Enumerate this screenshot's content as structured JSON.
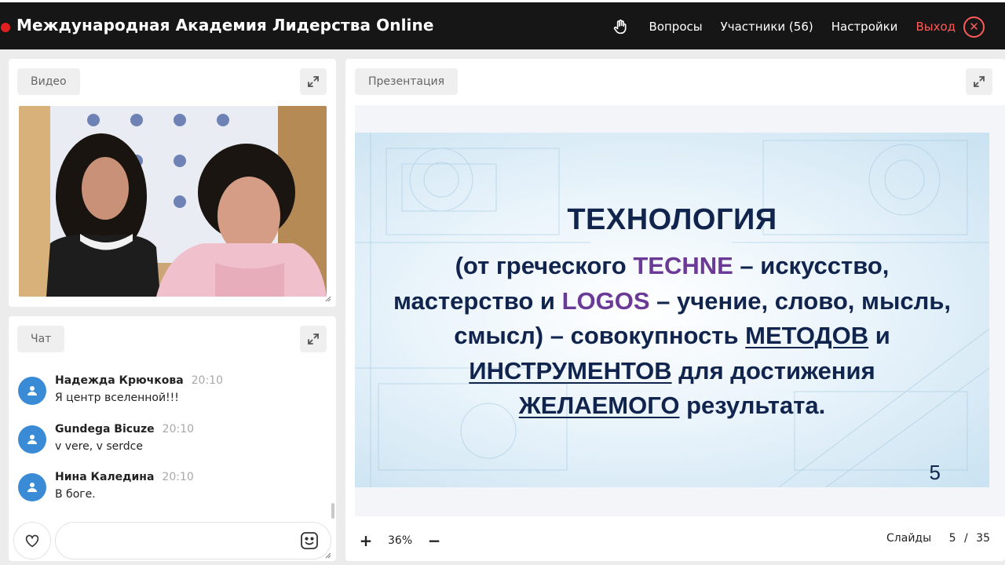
{
  "header": {
    "title": "Международная Академия Лидерства Online",
    "nav": {
      "questions": "Вопросы",
      "participants": "Участники (56)",
      "settings": "Настройки",
      "exit": "Выход"
    }
  },
  "video_panel": {
    "tab_label": "Видео"
  },
  "chat_panel": {
    "tab_label": "Чат",
    "messages": [
      {
        "name": "Надежда Крючкова",
        "time": "20:10",
        "text": "Я центр вселенной!!!"
      },
      {
        "name": "Gundega Bicuze",
        "time": "20:10",
        "text": "v vere, v serdce"
      },
      {
        "name": "Нина Каледина",
        "time": "20:10",
        "text": "В боге."
      }
    ],
    "input_value": ""
  },
  "presentation_panel": {
    "tab_label": "Презентация",
    "slide": {
      "title": "ТЕХНОЛОГИЯ",
      "l1a": "(от греческого ",
      "l1b": "TECHNE",
      "l1c": " – искусство,",
      "l2a": "мастерство и ",
      "l2b": "LOGOS",
      "l2c": " – учение, слово, мысль,",
      "l3a": "смысл) – совокупность ",
      "l3b": "МЕТОДОВ",
      "l3c": " и",
      "l4a": "ИНСТРУМЕНТОВ",
      "l4b": " для достижения",
      "l5a": "ЖЕЛАЕМОГО",
      "l5b": " результата.",
      "page_number": "5"
    },
    "zoom": {
      "plus": "+",
      "value": "36%",
      "minus": "−"
    },
    "slides": {
      "label": "Слайды",
      "current": "5",
      "separator": "/",
      "total": "35"
    }
  },
  "colors": {
    "topbar": "#161616",
    "exit_accent": "#ff5a5a",
    "avatar": "#3a8bd6",
    "slide_text": "#10244d",
    "slide_highlight": "#6a3a96"
  },
  "icons": {
    "raise_hand": "hand-icon",
    "close": "close-icon",
    "expand": "expand-icon",
    "avatar": "user-icon",
    "like": "heart-icon",
    "emoji": "smiley-icon"
  }
}
